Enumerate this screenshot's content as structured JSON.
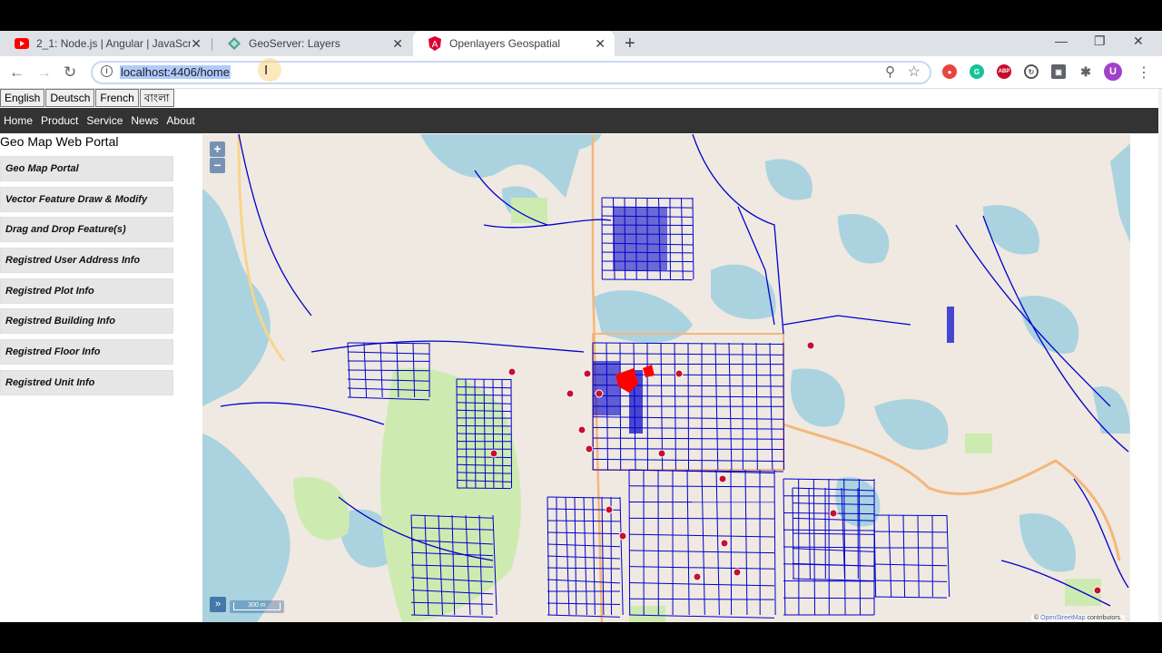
{
  "browser": {
    "tabs": [
      {
        "title": "2_1: Node.js | Angular | JavaScrip",
        "icon": "youtube-icon",
        "active": false
      },
      {
        "title": "GeoServer: Layers",
        "icon": "geoserver-icon",
        "active": false
      },
      {
        "title": "Openlayers Geospatial",
        "icon": "angular-icon",
        "active": true
      }
    ],
    "url": "localhost:4406/home",
    "profile_initial": "U"
  },
  "languages": [
    "English",
    "Deutsch",
    "French",
    "বাংলা"
  ],
  "nav": [
    "Home",
    "Product",
    "Service",
    "News",
    "About"
  ],
  "portal_title": "Geo Map Web Portal",
  "sidebar": [
    "Geo Map Portal",
    "Vector Feature Draw & Modify",
    "Drag and Drop Feature(s)",
    "Registred User Address Info",
    "Registred Plot Info",
    "Registred Building Info",
    "Registred Floor Info",
    "Registred Unit Info"
  ],
  "map": {
    "zoom_in": "+",
    "zoom_out": "−",
    "scale": "300 m",
    "attribution_prefix": "©",
    "attribution_link": "OpenStreetMap",
    "attribution_suffix": "contributors.",
    "colors": {
      "water": "#aad3df",
      "park": "#cdebb0",
      "land": "#efe9e1",
      "vector": "#0000cc",
      "highlight": "#ff0000"
    }
  }
}
